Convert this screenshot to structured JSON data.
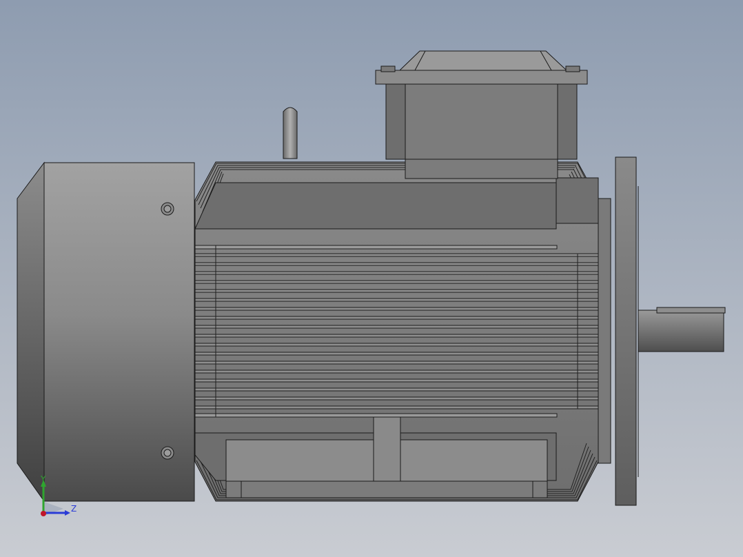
{
  "viewport": {
    "background_top": "#8e9cb0",
    "background_bottom": "#c9ccd2"
  },
  "model": {
    "subject": "electric-motor",
    "body_color": "#7a7a7a",
    "edge_color": "#1a1a1a"
  },
  "triad": {
    "y_label": "Y",
    "z_label": "Z",
    "y_color": "#2fa52f",
    "z_color": "#2a3bd6",
    "origin_color": "#c0162a"
  }
}
